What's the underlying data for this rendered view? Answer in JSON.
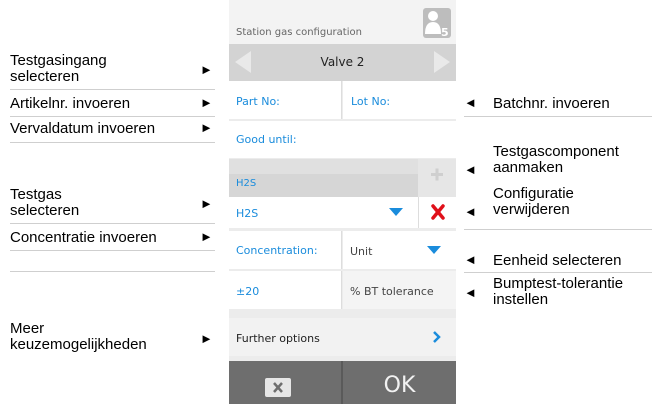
{
  "annotations": {
    "left": [
      {
        "label": "Testgasingang\nselecteren"
      },
      {
        "label": "Artikelnr. invoeren"
      },
      {
        "label": "Vervaldatum invoeren"
      },
      {
        "label": "Testgas\nselecteren"
      },
      {
        "label": "Concentratie invoeren"
      },
      {
        "label": "Meer\nkeuzemogelijkheden"
      }
    ],
    "right": [
      {
        "label": "Batchnr. invoeren"
      },
      {
        "label": "Testgascomponent\naanmaken"
      },
      {
        "label": "Configuratie\nverwijderen"
      },
      {
        "label": "Eenheid selecteren"
      },
      {
        "label": "Bumptest-tolerantie\ninstellen"
      }
    ],
    "arrow_right": "►",
    "arrow_left": "◄"
  },
  "device": {
    "header_title": "Station gas configuration",
    "header_icon": "user-level-icon",
    "user_level": "5",
    "valve_label": "Valve 2",
    "part_no_label": "Part No:",
    "lot_no_label": "Lot No:",
    "good_until_label": "Good until:",
    "gas_header": "H2S",
    "gas_select_value": "H2S",
    "concentration_label": "Concentration:",
    "unit_select_value": "Unit",
    "tolerance_value": "±20",
    "tolerance_unit": "% BT tolerance",
    "further_options_label": "Further options",
    "ok_label": "OK",
    "colors": {
      "accent_blue": "#1a8cdc",
      "delete_red": "#e0101a",
      "bottom_bar": "#6b6b6b"
    }
  }
}
